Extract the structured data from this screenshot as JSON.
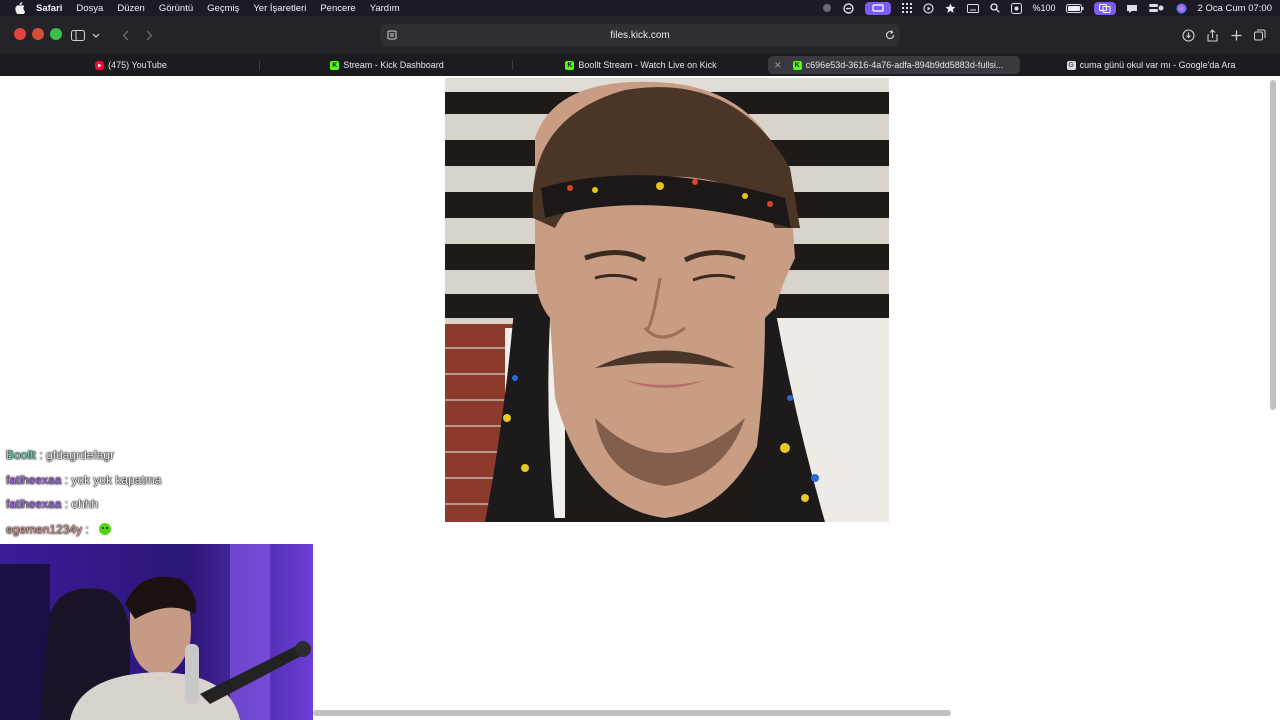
{
  "menubar": {
    "app_name": "Safari",
    "items": [
      "Dosya",
      "Düzen",
      "Görüntü",
      "Geçmiş",
      "Yer İşaretleri",
      "Pencere",
      "Yardım"
    ],
    "battery": "%100",
    "clock": "2 Oca Cum  07:00"
  },
  "toolbar": {
    "url": "files.kick.com"
  },
  "tabs": [
    {
      "label": "(475) YouTube",
      "favicon": "youtube-icon",
      "color": "#ff0033"
    },
    {
      "label": "Stream - Kick Dashboard",
      "favicon": "kick-icon",
      "color": "#53fc18"
    },
    {
      "label": "Boollt Stream - Watch Live on Kick",
      "favicon": "kick-icon",
      "color": "#53fc18"
    },
    {
      "label": "c696e53d-3616-4a76-adfa-894b9dd5883d-fullsi...",
      "favicon": "kick-icon",
      "color": "#53fc18",
      "active": true
    },
    {
      "label": "cuma günü okul var mı - Google'da Ara",
      "favicon": "google-icon",
      "color": "#dcdcdc"
    }
  ],
  "chat": [
    {
      "user": "Boollt",
      "sep": " : ",
      "msg": "gfdagrdefagr",
      "color": "#6fe3c9"
    },
    {
      "user": "fatiheexaa",
      "sep": " : ",
      "msg": "yok yok kapatma",
      "color": "#a56bf2"
    },
    {
      "user": "fatiheexaa",
      "sep": " : ",
      "msg": "ohhh",
      "color": "#a56bf2"
    },
    {
      "user": "egemen1234y",
      "sep": " : ",
      "msg": "",
      "color": "#e8a0a0"
    }
  ],
  "colors": {
    "menubar_bg": "#1d1a26",
    "toolbar_bg": "#242328",
    "kick_green": "#53fc18",
    "accent_purple": "#7b5cf0"
  }
}
